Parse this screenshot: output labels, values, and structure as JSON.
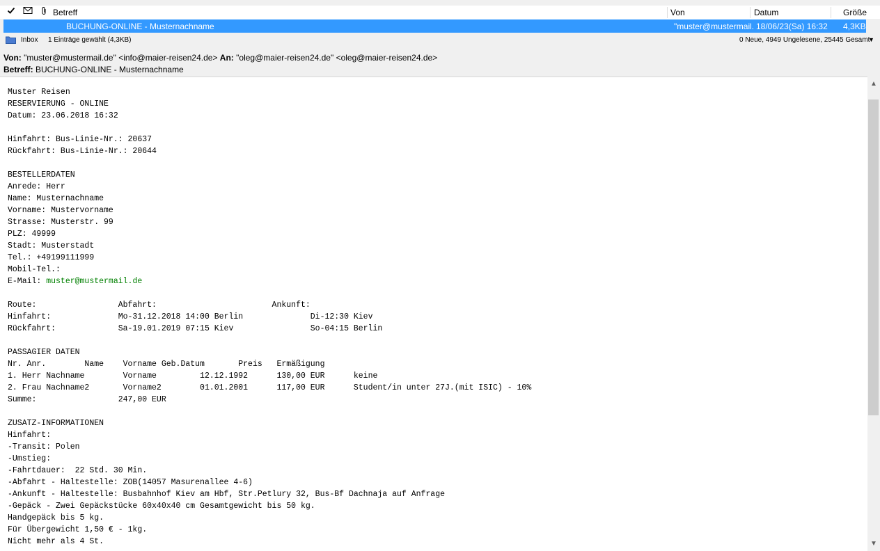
{
  "list_header": {
    "subject_col": "Betreff",
    "from_col": "Von",
    "date_col": "Datum",
    "size_col": "Größe"
  },
  "selected_message": {
    "subject": "BUCHUNG-ONLINE - Musternachname",
    "from": "\"muster@mustermail.",
    "date": "18/06/23(Sa) 16:32",
    "size": "4,3KB"
  },
  "status_bar": {
    "folder": "Inbox",
    "selection": "1 Einträge gewählt (4,3KB)",
    "counts": "0 Neue, 4949 Ungelesene, 25445 Gesamt"
  },
  "header": {
    "from_label": "Von:",
    "from_value": "\"muster@mustermail.de\" <info@maier-reisen24.de>",
    "to_label": "An:",
    "to_value": "\"oleg@maier-reisen24.de\" <oleg@maier-reisen24.de>",
    "subject_label": "Betreff:",
    "subject_value": "BUCHUNG-ONLINE - Musternachname"
  },
  "body_lines": [
    "Muster Reisen",
    "RESERVIERUNG - ONLINE",
    "Datum: 23.06.2018 16:32",
    "",
    "Hinfahrt: Bus-Linie-Nr.: 20637",
    "Rückfahrt: Bus-Linie-Nr.: 20644",
    "",
    "BESTELLERDATEN",
    "Anrede: Herr",
    "Name: Musternachname",
    "Vorname: Mustervorname",
    "Strasse: Musterstr. 99",
    "PLZ: 49999",
    "Stadt: Musterstadt",
    "Tel.: +49199111999",
    "Mobil-Tel.:",
    "E-Mail: ",
    "",
    "Route:                 Abfahrt:                        Ankunft:",
    "Hinfahrt:              Mo-31.12.2018 14:00 Berlin              Di-12:30 Kiev",
    "Rückfahrt:             Sa-19.01.2019 07:15 Kiev                So-04:15 Berlin",
    "",
    "PASSAGIER DATEN",
    "Nr. Anr.        Name    Vorname Geb.Datum       Preis   Ermäßigung",
    "1. Herr Nachname        Vorname         12.12.1992      130,00 EUR      keine",
    "2. Frau Nachname2       Vorname2        01.01.2001      117,00 EUR      Student/in unter 27J.(mit ISIC) - 10%",
    "Summe:                 247,00 EUR",
    "",
    "ZUSATZ-INFORMATIONEN",
    "Hinfahrt:",
    "-Transit: Polen",
    "-Umstieg:",
    "-Fahrtdauer:  22 Std. 30 Min.",
    "-Abfahrt - Haltestelle: ZOB(14057 Masurenallee 4-6)",
    "-Ankunft - Haltestelle: Busbahnhof Kiev am Hbf, Str.Petlury 32, Bus-Bf Dachnaja auf Anfrage",
    "-Gepäck - Zwei Gepäckstücke 60x40x40 cm Gesamtgewicht bis 50 kg.",
    "Handgepäck bis 5 kg.",
    "Für Übergewicht 1,50 € - 1kg.",
    "Nicht mehr als 4 St."
  ],
  "email_link": "muster@mustermail.de",
  "colors": {
    "selection": "#3399ff",
    "link": "#008000"
  }
}
